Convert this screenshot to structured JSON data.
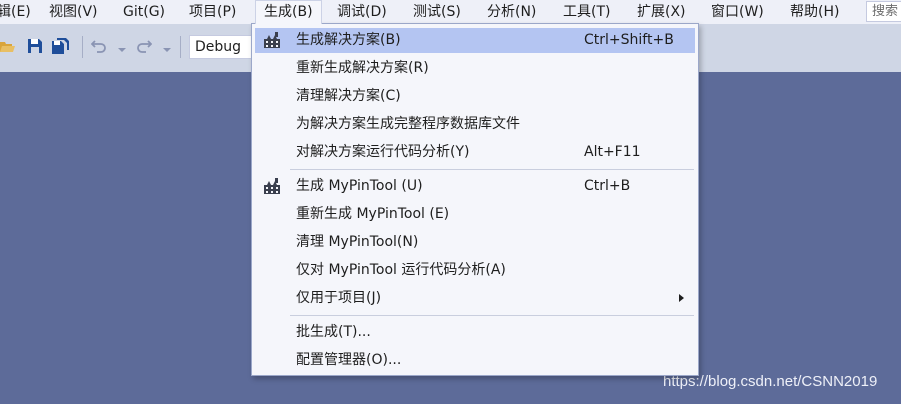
{
  "menubar": {
    "items": [
      {
        "label": "辑(E)"
      },
      {
        "label": "视图(V)"
      },
      {
        "label": "Git(G)"
      },
      {
        "label": "项目(P)"
      },
      {
        "label": "生成(B)"
      },
      {
        "label": "调试(D)"
      },
      {
        "label": "测试(S)"
      },
      {
        "label": "分析(N)"
      },
      {
        "label": "工具(T)"
      },
      {
        "label": "扩展(X)"
      },
      {
        "label": "窗口(W)"
      },
      {
        "label": "帮助(H)"
      }
    ],
    "search_placeholder": "搜索"
  },
  "toolbar": {
    "configuration": "Debug",
    "icons": [
      "open-folder-icon",
      "save-icon",
      "save-all-icon",
      "undo-icon",
      "redo-icon"
    ]
  },
  "build_menu": {
    "items": [
      {
        "label": "生成解决方案(B)",
        "shortcut": "Ctrl+Shift+B",
        "icon": "build-icon",
        "highlighted": true
      },
      {
        "label": "重新生成解决方案(R)",
        "shortcut": ""
      },
      {
        "label": "清理解决方案(C)",
        "shortcut": ""
      },
      {
        "label": "为解决方案生成完整程序数据库文件",
        "shortcut": ""
      },
      {
        "label": "对解决方案运行代码分析(Y)",
        "shortcut": "Alt+F11"
      },
      {
        "label": "生成 MyPinTool (U)",
        "shortcut": "Ctrl+B",
        "icon": "build-icon"
      },
      {
        "label": "重新生成 MyPinTool (E)",
        "shortcut": ""
      },
      {
        "label": "清理 MyPinTool(N)",
        "shortcut": ""
      },
      {
        "label": "仅对 MyPinTool 运行代码分析(A)",
        "shortcut": ""
      },
      {
        "label": "仅用于项目(J)",
        "shortcut": "",
        "submenu": true
      },
      {
        "label": "批生成(T)...",
        "shortcut": ""
      },
      {
        "label": "配置管理器(O)...",
        "shortcut": ""
      }
    ]
  },
  "watermark": "https://blog.csdn.net/CSNN2019",
  "colors": {
    "background": "#5d6b99",
    "menubar": "#eef0f8",
    "toolbar": "#cfd6e5",
    "menu_bg": "#f5f6fb",
    "highlight": "#b4c5f2",
    "icon_blue": "#1f4e9a"
  }
}
